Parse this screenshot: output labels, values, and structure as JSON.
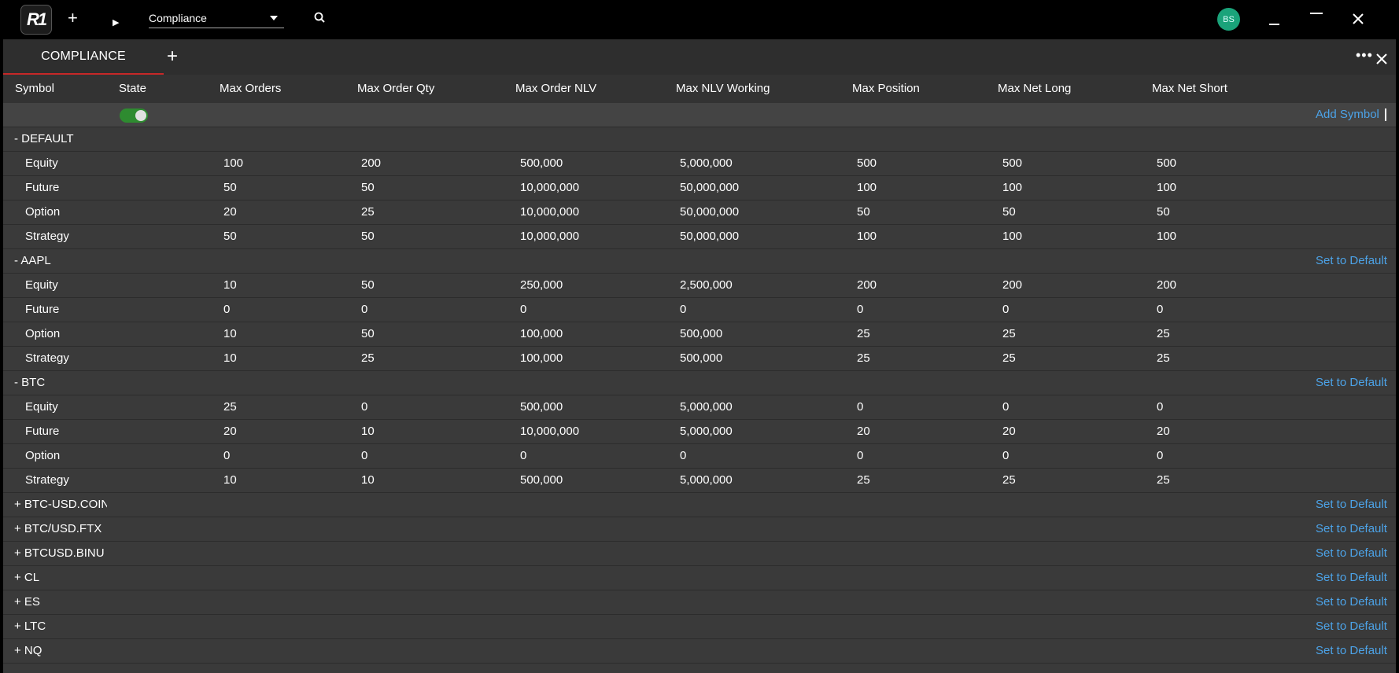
{
  "app": {
    "logo_text": "R1",
    "workspace_select": "Compliance",
    "user_initials": "BS"
  },
  "tab": {
    "label": "COMPLIANCE"
  },
  "table": {
    "columns": [
      "Symbol",
      "State",
      "Max Orders",
      "Max Order Qty",
      "Max Order NLV",
      "Max NLV Working",
      "Max Position",
      "Max Net Long",
      "Max Net Short"
    ],
    "add_symbol": "Add Symbol",
    "set_default": "Set to Default",
    "state_enabled": true,
    "groups": [
      {
        "label": "- DEFAULT",
        "action": "",
        "rows": [
          {
            "type": "Equity",
            "v": [
              "100",
              "200",
              "500,000",
              "5,000,000",
              "500",
              "500",
              "500"
            ]
          },
          {
            "type": "Future",
            "v": [
              "50",
              "50",
              "10,000,000",
              "50,000,000",
              "100",
              "100",
              "100"
            ]
          },
          {
            "type": "Option",
            "v": [
              "20",
              "25",
              "10,000,000",
              "50,000,000",
              "50",
              "50",
              "50"
            ]
          },
          {
            "type": "Strategy",
            "v": [
              "50",
              "50",
              "10,000,000",
              "50,000,000",
              "100",
              "100",
              "100"
            ]
          }
        ]
      },
      {
        "label": "- AAPL",
        "action": "Set to Default",
        "rows": [
          {
            "type": "Equity",
            "v": [
              "10",
              "50",
              "250,000",
              "2,500,000",
              "200",
              "200",
              "200"
            ]
          },
          {
            "type": "Future",
            "v": [
              "0",
              "0",
              "0",
              "0",
              "0",
              "0",
              "0"
            ]
          },
          {
            "type": "Option",
            "v": [
              "10",
              "50",
              "100,000",
              "500,000",
              "25",
              "25",
              "25"
            ]
          },
          {
            "type": "Strategy",
            "v": [
              "10",
              "25",
              "100,000",
              "500,000",
              "25",
              "25",
              "25"
            ]
          }
        ]
      },
      {
        "label": "- BTC",
        "action": "Set to Default",
        "rows": [
          {
            "type": "Equity",
            "v": [
              "25",
              "0",
              "500,000",
              "5,000,000",
              "0",
              "0",
              "0"
            ]
          },
          {
            "type": "Future",
            "v": [
              "20",
              "10",
              "10,000,000",
              "5,000,000",
              "20",
              "20",
              "20"
            ]
          },
          {
            "type": "Option",
            "v": [
              "0",
              "0",
              "0",
              "0",
              "0",
              "0",
              "0"
            ]
          },
          {
            "type": "Strategy",
            "v": [
              "10",
              "10",
              "500,000",
              "5,000,000",
              "25",
              "25",
              "25"
            ]
          }
        ]
      },
      {
        "label": "+ BTC-USD.COIN",
        "action": "Set to Default",
        "rows": []
      },
      {
        "label": "+ BTC/USD.FTX",
        "action": "Set to Default",
        "rows": []
      },
      {
        "label": "+ BTCUSD.BINU",
        "action": "Set to Default",
        "rows": []
      },
      {
        "label": "+ CL",
        "action": "Set to Default",
        "rows": []
      },
      {
        "label": "+ ES",
        "action": "Set to Default",
        "rows": []
      },
      {
        "label": "+ LTC",
        "action": "Set to Default",
        "rows": []
      },
      {
        "label": "+ NQ",
        "action": "Set to Default",
        "rows": []
      }
    ]
  },
  "colors": {
    "accent_red": "#c62828",
    "link": "#4ca3e8",
    "toggle_on": "#2e8b30",
    "avatar": "#1aa37a"
  }
}
